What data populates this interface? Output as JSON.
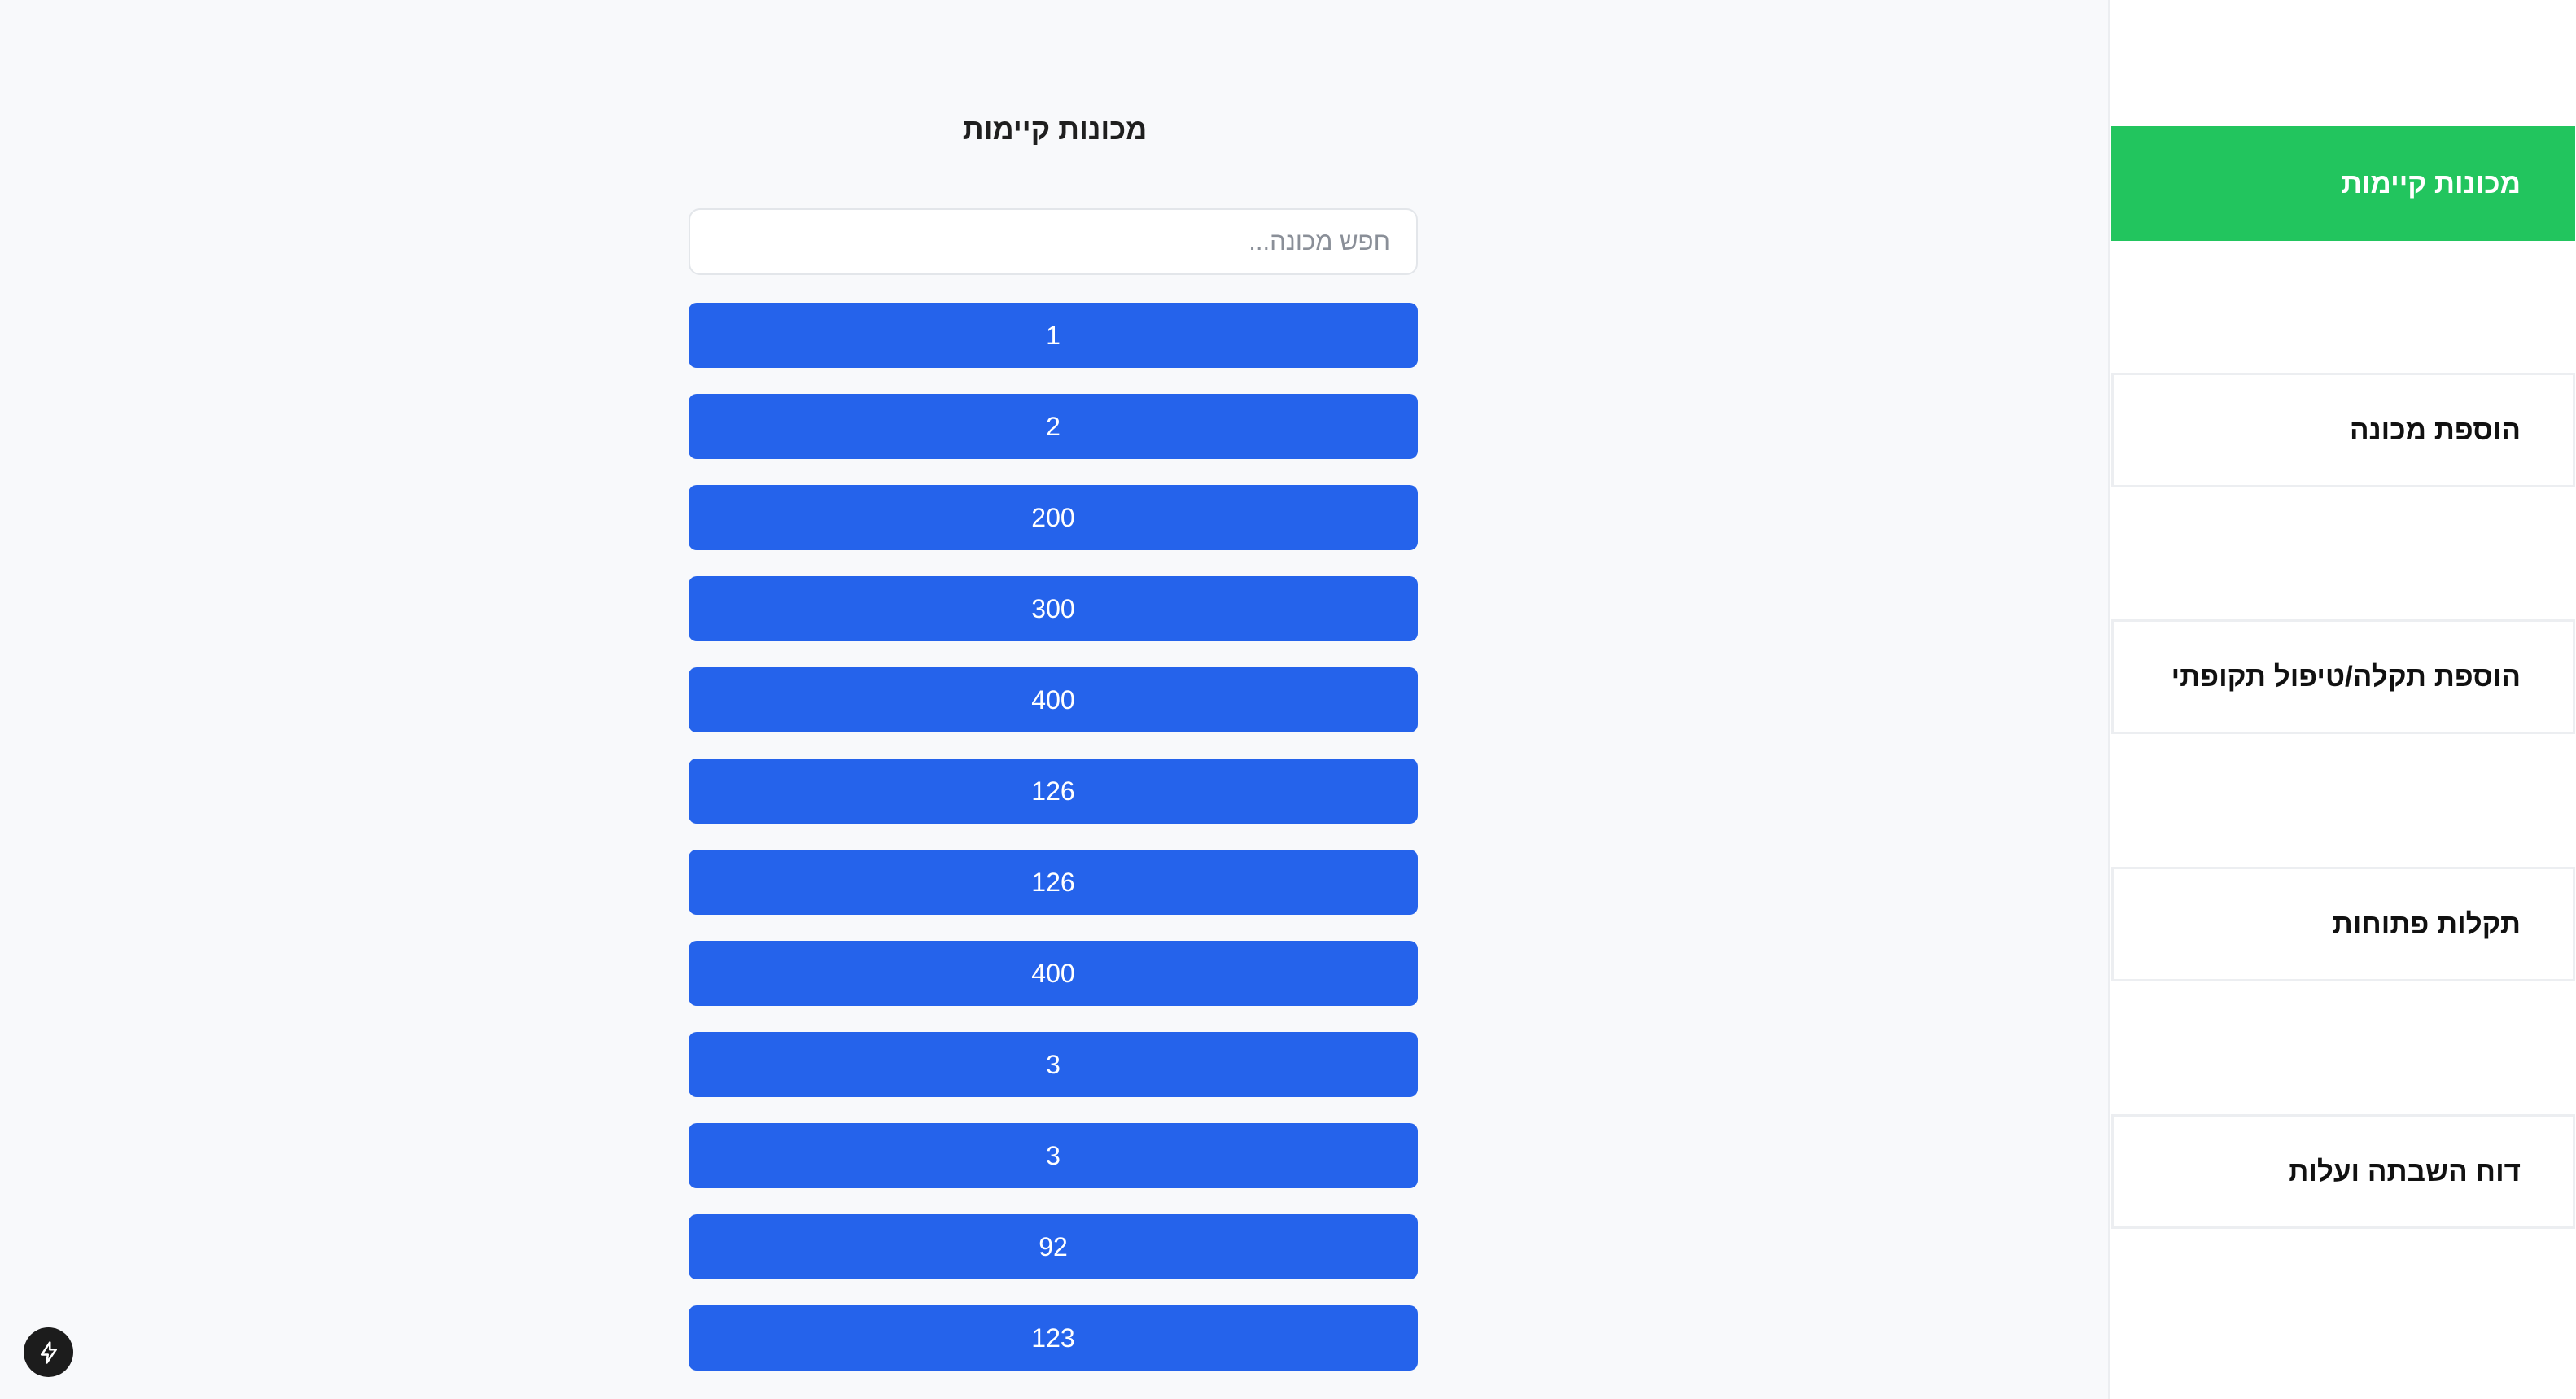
{
  "main": {
    "title": "מכונות קיימות",
    "search": {
      "placeholder": "חפש מכונה...",
      "value": ""
    },
    "machines": [
      "1",
      "2",
      "200",
      "300",
      "400",
      "126",
      "126",
      "400",
      "3",
      "3",
      "92",
      "123"
    ]
  },
  "sidebar": {
    "items": [
      {
        "label": "מכונות קיימות",
        "active": true
      },
      {
        "label": "הוספת מכונה",
        "active": false
      },
      {
        "label": "הוספת תקלה/טיפול תקופתי",
        "active": false
      },
      {
        "label": "תקלות פתוחות",
        "active": false
      },
      {
        "label": "דוח השבתה ועלות",
        "active": false
      }
    ]
  },
  "colors": {
    "accent_green": "#22c55e",
    "button_blue": "#2563eb",
    "background": "#f8f9fb"
  },
  "icons": {
    "floating_button": "lightning-bolt-icon"
  }
}
